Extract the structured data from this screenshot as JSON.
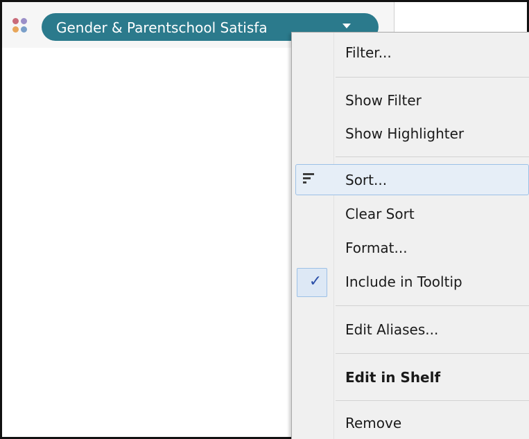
{
  "shelf": {
    "pill_label": "Gender & Parentschool Satisfa",
    "dot_colors": [
      "#c96b7a",
      "#9b8fc8",
      "#e8a65a",
      "#7a9fc9"
    ],
    "pill_color": "#2b7a8c"
  },
  "context_menu": {
    "items": {
      "filter": "Filter...",
      "show_filter": "Show Filter",
      "show_highlighter": "Show Highlighter",
      "sort": "Sort...",
      "clear_sort": "Clear Sort",
      "format": "Format...",
      "include_in_tooltip": "Include in Tooltip",
      "edit_aliases": "Edit Aliases...",
      "edit_in_shelf": "Edit in Shelf",
      "remove": "Remove"
    },
    "highlighted_item": "Sort...",
    "checked_items": [
      "Include in Tooltip"
    ],
    "icons": {
      "sort": "sort-icon",
      "check": "checkmark-icon",
      "check_glyph": "✓"
    }
  }
}
